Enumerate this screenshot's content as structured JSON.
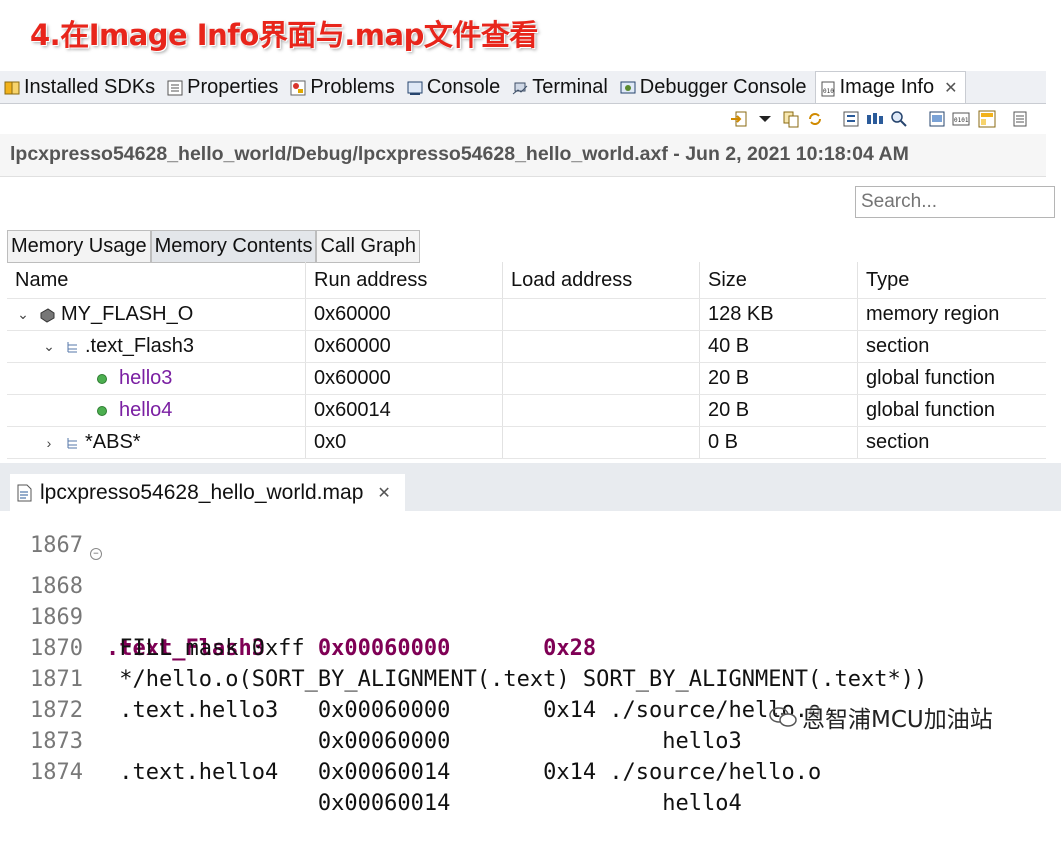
{
  "heading": "4.在Image Info界面与.map文件查看",
  "view_tabs": [
    {
      "label": "Installed SDKs",
      "icon": "sdk-icon"
    },
    {
      "label": "Properties",
      "icon": "properties-icon"
    },
    {
      "label": "Problems",
      "icon": "problems-icon"
    },
    {
      "label": "Console",
      "icon": "console-icon"
    },
    {
      "label": "Terminal",
      "icon": "terminal-icon"
    },
    {
      "label": "Debugger Console",
      "icon": "debugger-console-icon"
    },
    {
      "label": "Image Info",
      "icon": "image-info-icon",
      "active": true
    }
  ],
  "close_glyph": "✕",
  "path_line": "lpcxpresso54628_hello_world/Debug/lpcxpresso54628_hello_world.axf - Jun 2, 2021 10:18:04 AM",
  "search": {
    "placeholder": "Search..."
  },
  "subtabs": [
    "Memory Usage",
    "Memory Contents",
    "Call Graph"
  ],
  "table": {
    "columns": [
      "Name",
      "Run address",
      "Load address",
      "Size",
      "Type"
    ],
    "rows": [
      {
        "name": "MY_FLASH_O",
        "run": "0x60000",
        "load": "",
        "size": "128 KB",
        "type": "memory region",
        "expander": "expanded",
        "icon": "memory-region-icon"
      },
      {
        "name": ".text_Flash3",
        "run": "0x60000",
        "load": "",
        "size": "40 B",
        "type": "section",
        "expander": "expanded",
        "icon": "section-icon"
      },
      {
        "name": "hello3",
        "run": "0x60000",
        "load": "",
        "size": "20 B",
        "type": "global function",
        "expander": "none",
        "icon": "function-dot-icon"
      },
      {
        "name": "hello4",
        "run": "0x60014",
        "load": "",
        "size": "20 B",
        "type": "global function",
        "expander": "none",
        "icon": "function-dot-icon"
      },
      {
        "name": "*ABS*",
        "run": "0x0",
        "load": "",
        "size": "0 B",
        "type": "section",
        "expander": "collapsed",
        "icon": "section-icon"
      }
    ]
  },
  "editor": {
    "tab_label": "lpcxpresso54628_hello_world.map",
    "lines": [
      {
        "num": "1867",
        "text": ""
      },
      {
        "num": "1868",
        "text": ".text_Flash3    0x00060000       0x28",
        "highlight": true
      },
      {
        "num": "1869",
        "text": " FILL mask 0xff"
      },
      {
        "num": "1870",
        "text": " */hello.o(SORT_BY_ALIGNMENT(.text) SORT_BY_ALIGNMENT(.text*))"
      },
      {
        "num": "1871",
        "text": " .text.hello3   0x00060000       0x14 ./source/hello.o"
      },
      {
        "num": "1872",
        "text": "                0x00060000                hello3"
      },
      {
        "num": "1873",
        "text": " .text.hello4   0x00060014       0x14 ./source/hello.o"
      },
      {
        "num": "1874",
        "text": "                0x00060014                hello4"
      }
    ]
  },
  "watermark": "恩智浦MCU加油站",
  "colors": {
    "heading": "#e8251b",
    "keyword": "#7f0055",
    "function_name": "#7a1fa2"
  }
}
